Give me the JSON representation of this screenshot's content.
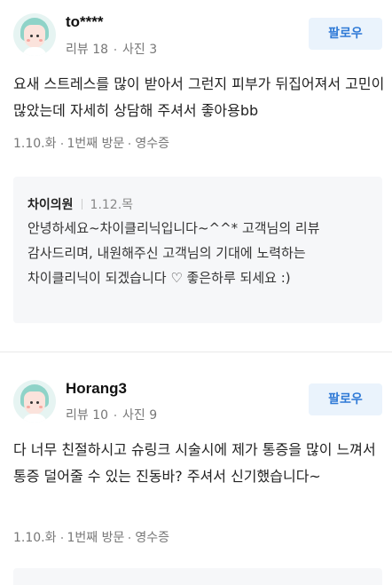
{
  "reviews": [
    {
      "nickname": "to****",
      "reviews_label": "리뷰 18",
      "photos_label": "사진 3",
      "follow_label": "팔로우",
      "body": "요새 스트레스를 많이 받아서 그런지 피부가 뒤집어져서 고민이 많았는데 자세히 상담해 주셔서 좋아용bb",
      "date": "1.10.화",
      "visit": "1번째 방문",
      "receipt": "영수증",
      "reply": {
        "name": "차이의원",
        "date": "1.12.목",
        "text": "안녕하세요~차이클리닉입니다~^^* 고객님의 리뷰 감사드리며, 내원해주신 고객님의 기대에 노력하는 차이클리닉이 되겠습니다 ♡ 좋은하루 되세요 :)"
      }
    },
    {
      "nickname": "Horang3",
      "reviews_label": "리뷰 10",
      "photos_label": "사진 9",
      "follow_label": "팔로우",
      "body": "다 너무 친절하시고 슈링크 시술시에 제가 통증을 많이 느껴서 통증 덜어줄 수 있는 진동바? 주셔서 신기했습니다~",
      "date": "1.10.화",
      "visit": "1번째 방문",
      "receipt": "영수증"
    }
  ],
  "colors": {
    "follow_bg": "#eaf3fc",
    "follow_text": "#2f7ad6",
    "reply_bg": "#f6f7f9",
    "avatar_hair": "#8fd3c8"
  }
}
